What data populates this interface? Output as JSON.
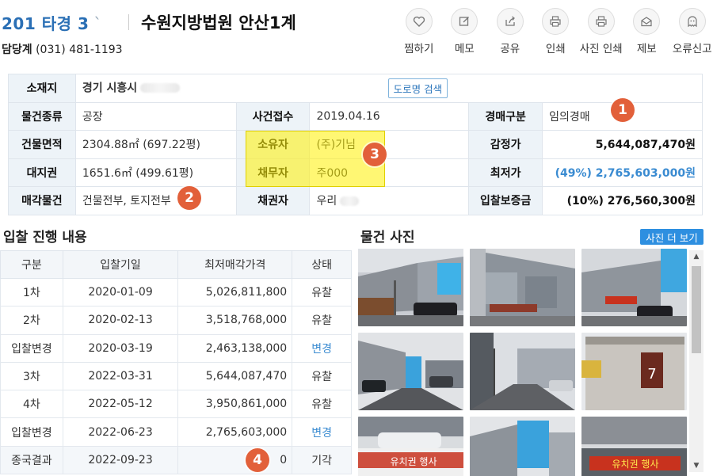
{
  "header": {
    "case_number": "201  타경 3",
    "case_mark": "`",
    "court": "수원지방법원 안산1계",
    "contact_label": "담당계",
    "contact_phone": "(031) 481-1193"
  },
  "actions": [
    {
      "label": "찜하기",
      "icon": "heart-icon"
    },
    {
      "label": "메모",
      "icon": "memo-icon"
    },
    {
      "label": "공유",
      "icon": "share-icon"
    },
    {
      "label": "인쇄",
      "icon": "print-icon"
    },
    {
      "label": "사진 인쇄",
      "icon": "photo-print-icon"
    },
    {
      "label": "제보",
      "icon": "envelope-icon"
    },
    {
      "label": "오류신고",
      "icon": "ghost-icon"
    }
  ],
  "info": {
    "location_label": "소재지",
    "location_value": "경기 시흥시",
    "road_search": "도로명 검색",
    "type_label": "물건종류",
    "type_value": "공장",
    "received_label": "사건접수",
    "received_value": "2019.04.16",
    "auction_label": "경매구분",
    "auction_value": "임의경매",
    "area_label": "건물면적",
    "area_value": "2304.88㎡ (697.22평)",
    "owner_label": "소유자",
    "owner_value": "(주)기님",
    "appraisal_label": "감정가",
    "appraisal_value": "5,644,087,470원",
    "land_label": "대지권",
    "land_value": "1651.6㎡ (499.61평)",
    "debtor_label": "채무자",
    "debtor_value": "주000",
    "minimum_label": "최저가",
    "minimum_value": "(49%) 2,765,603,000원",
    "sale_label": "매각물건",
    "sale_value": "건물전부, 토지전부",
    "creditor_label": "채권자",
    "creditor_value": "우리",
    "deposit_label": "입찰보증금",
    "deposit_value": "(10%) 276,560,300원"
  },
  "badges": [
    "1",
    "2",
    "3",
    "4"
  ],
  "bid_section": {
    "title": "입찰 진행 내용",
    "columns": [
      "구분",
      "입찰기일",
      "최저매각가격",
      "상태"
    ],
    "rows": [
      {
        "round": "1차",
        "date": "2020-01-09",
        "price": "5,026,811,800",
        "status": "유찰",
        "blue": false
      },
      {
        "round": "2차",
        "date": "2020-02-13",
        "price": "3,518,768,000",
        "status": "유찰",
        "blue": false
      },
      {
        "round": "입찰변경",
        "date": "2020-03-19",
        "price": "2,463,138,000",
        "status": "변경",
        "blue": true
      },
      {
        "round": "3차",
        "date": "2022-03-31",
        "price": "5,644,087,470",
        "status": "유찰",
        "blue": false
      },
      {
        "round": "4차",
        "date": "2022-05-12",
        "price": "3,950,861,000",
        "status": "유찰",
        "blue": false
      },
      {
        "round": "입찰변경",
        "date": "2022-06-23",
        "price": "2,765,603,000",
        "status": "변경",
        "blue": true
      },
      {
        "round": "종국결과",
        "date": "2022-09-23",
        "price": "0",
        "status": "기각",
        "blue": false
      }
    ]
  },
  "photo_section": {
    "title": "물건 사진",
    "more_button": "사진 더 보기",
    "photos": [
      {
        "name": "photo-factory-front"
      },
      {
        "name": "photo-factory-side"
      },
      {
        "name": "photo-factory-banner",
        "sign": "현수막"
      },
      {
        "name": "photo-street-1"
      },
      {
        "name": "photo-street-2"
      },
      {
        "name": "photo-gate-pillar",
        "sign": "7"
      },
      {
        "name": "photo-parking",
        "sign": "유치권 행사"
      },
      {
        "name": "photo-building-blue"
      },
      {
        "name": "photo-banner-wall",
        "sign": "유치권 행사"
      }
    ]
  },
  "colors": {
    "accent": "#2a6fb5",
    "badge": "#e2603a",
    "highlight": "#fff000",
    "link_blue": "#3a8bd1"
  }
}
